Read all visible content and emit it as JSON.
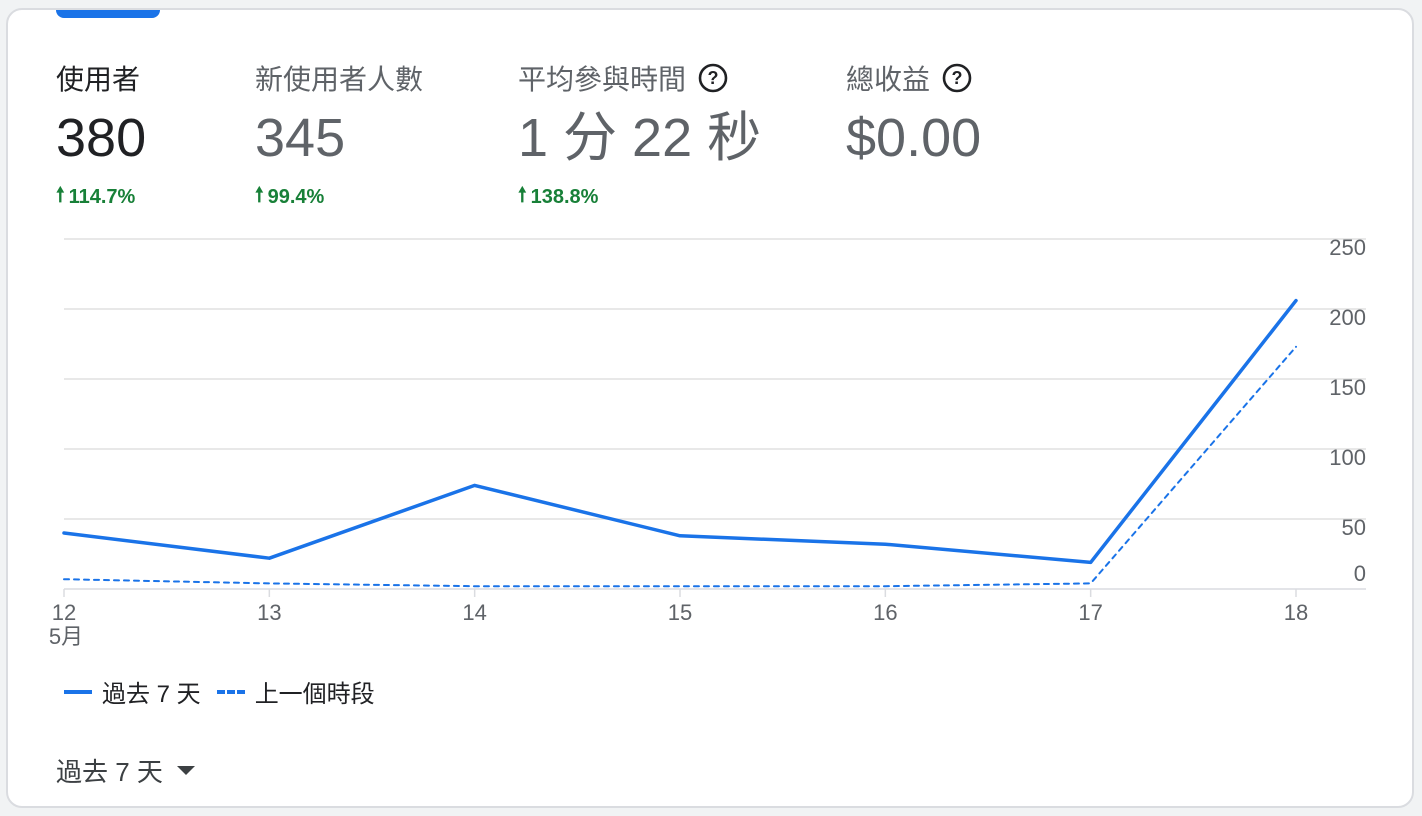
{
  "metrics": [
    {
      "label": "使用者",
      "value": "380",
      "delta": "114.7%"
    },
    {
      "label": "新使用者人數",
      "value": "345",
      "delta": "99.4%"
    },
    {
      "label": "平均參與時間",
      "value": "1 分 22 秒",
      "delta": "138.8%"
    },
    {
      "label": "總收益",
      "value": "$0.00",
      "delta": ""
    }
  ],
  "colors": {
    "accent": "#1a73e8",
    "positive": "#188038",
    "grid": "#e0e0e0"
  },
  "chart_data": {
    "type": "line",
    "categories": [
      "12",
      "13",
      "14",
      "15",
      "16",
      "17",
      "18"
    ],
    "month_label": "5月",
    "series": [
      {
        "name": "過去 7 天",
        "style": "solid",
        "values": [
          40,
          22,
          74,
          38,
          32,
          19,
          206
        ]
      },
      {
        "name": "上一個時段",
        "style": "dashed",
        "values": [
          7,
          4,
          2,
          2,
          2,
          4,
          173
        ]
      }
    ],
    "y_ticks": [
      "250",
      "200",
      "150",
      "100",
      "50",
      "0"
    ],
    "ylim": [
      0,
      250
    ],
    "y_axis_side": "right",
    "grid": true,
    "legend_position": "bottom-left"
  },
  "range_selector": {
    "label": "過去 7 天"
  }
}
